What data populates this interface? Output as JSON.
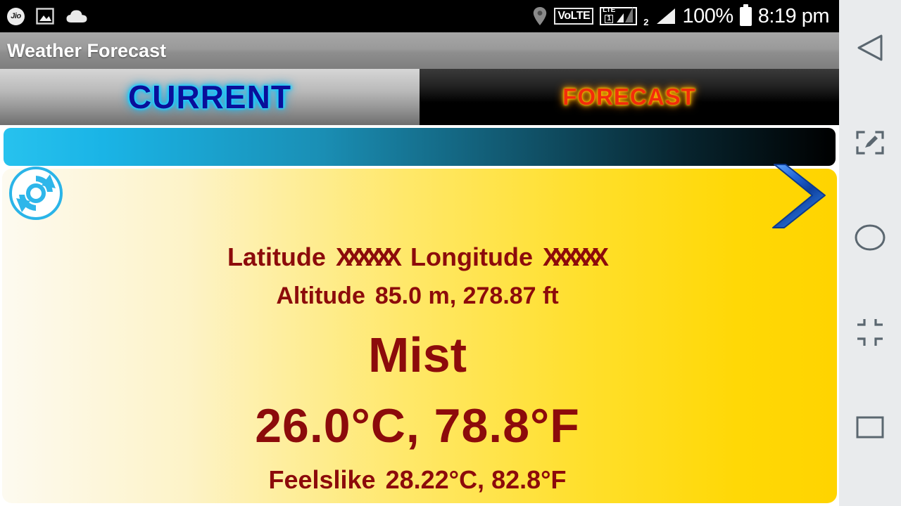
{
  "status_bar": {
    "carrier": "Jio",
    "icons": [
      "jio-logo",
      "screenshot-icon",
      "cloud-icon",
      "location-pin-icon",
      "volte-icon",
      "lte-signal-icon",
      "signal-2-icon",
      "battery-icon"
    ],
    "volte_label": "VoLTE",
    "lte_label": "LTE",
    "sim1_label": "1",
    "sim2_label": "2",
    "battery_percent": "100%",
    "time": "8:19 pm",
    "background_color": "#000000"
  },
  "app": {
    "title": "Weather Forecast",
    "title_bar_color": "#8e8e8e"
  },
  "tabs": [
    {
      "label": "CURRENT",
      "selected": true,
      "text_color": "#0a0f9a",
      "glow_color": "#35e2ff"
    },
    {
      "label": "FORECAST",
      "selected": false,
      "text_color": "#f22d0c",
      "glow_color": "#ffd000"
    }
  ],
  "banner": {
    "text": "",
    "gradient_from": "#27c2ee",
    "gradient_to": "#000000"
  },
  "card": {
    "refresh_icon": "refresh-icon",
    "next_icon": "chevron-right-icon",
    "latitude_label": "Latitude",
    "latitude_value": "XXXXXX",
    "longitude_label": "Longitude",
    "longitude_value": "XXXXXX",
    "altitude_label": "Altitude",
    "altitude_value": "85.0 m,  278.87 ft",
    "condition": "Mist",
    "temperature": "26.0°C,  78.8°F",
    "feelslike_label": "Feelslike",
    "feelslike_value": "28.22°C,  82.8°F",
    "text_color": "#8c0b0b",
    "background_from": "#fdfaf0",
    "background_to": "#ffd400"
  },
  "nav_bar": {
    "items": [
      {
        "name": "back",
        "icon": "back-triangle-icon"
      },
      {
        "name": "screenshot",
        "icon": "screenshot-edit-icon"
      },
      {
        "name": "home",
        "icon": "home-circle-icon"
      },
      {
        "name": "shrink",
        "icon": "shrink-screen-icon"
      },
      {
        "name": "recents",
        "icon": "recents-square-icon"
      }
    ],
    "background_color": "#e9ebed"
  }
}
